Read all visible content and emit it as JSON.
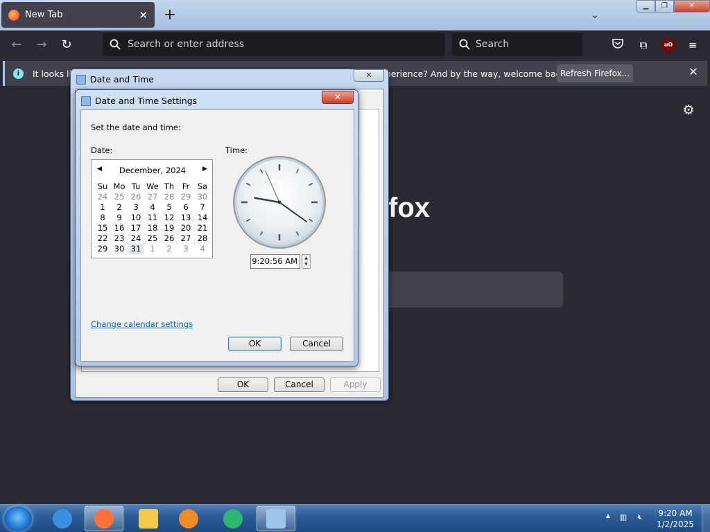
{
  "browser": {
    "tab_title": "New Tab",
    "new_tab_symbol": "+",
    "tab_close_symbol": "✕",
    "tab_list_symbol": "⌄",
    "address_placeholder": "Search or enter address",
    "search_placeholder": "Search",
    "ublock_badge": "uO",
    "notification": {
      "text_left": "It looks like",
      "text_right": "experience? And by the way, welcome back!",
      "button": "Refresh Firefox..."
    },
    "brand_text": "fox",
    "accent": "#a0c4ff"
  },
  "dialog_back": {
    "title": "Date and Time",
    "ok": "OK",
    "cancel": "Cancel",
    "apply": "Apply"
  },
  "dialog_front": {
    "title": "Date and Time Settings",
    "heading": "Set the date and time:",
    "date_label": "Date:",
    "time_label": "Time:",
    "calendar": {
      "month_label": "December, 2024",
      "weekdays": [
        "Su",
        "Mo",
        "Tu",
        "We",
        "Th",
        "Fr",
        "Sa"
      ],
      "days": [
        [
          "24",
          "25",
          "26",
          "27",
          "28",
          "29",
          "30"
        ],
        [
          "1",
          "2",
          "3",
          "4",
          "5",
          "6",
          "7"
        ],
        [
          "8",
          "9",
          "10",
          "11",
          "12",
          "13",
          "14"
        ],
        [
          "15",
          "16",
          "17",
          "18",
          "19",
          "20",
          "21"
        ],
        [
          "22",
          "23",
          "24",
          "25",
          "26",
          "27",
          "28"
        ],
        [
          "29",
          "30",
          "31",
          "1",
          "2",
          "3",
          "4"
        ]
      ],
      "selected_day": "31"
    },
    "clock": {
      "hours": 9,
      "minutes": 20,
      "seconds": 56
    },
    "time_value": "9:20:56 AM",
    "change_calendar_link": "Change calendar settings",
    "ok": "OK",
    "cancel": "Cancel"
  },
  "taskbar": {
    "clock_time": "9:20 AM",
    "clock_date": "1/2/2025",
    "apps": [
      {
        "name": "internet-explorer",
        "color": "#3b8fe0",
        "active": false
      },
      {
        "name": "firefox",
        "color": "#ff7139",
        "active": true
      },
      {
        "name": "file-explorer",
        "color": "#f2c94c",
        "active": false
      },
      {
        "name": "media-player",
        "color": "#f08a24",
        "active": false
      },
      {
        "name": "green-app",
        "color": "#2bb673",
        "active": false
      },
      {
        "name": "date-time-control-panel",
        "color": "#9cc6ea",
        "active": true
      }
    ]
  }
}
